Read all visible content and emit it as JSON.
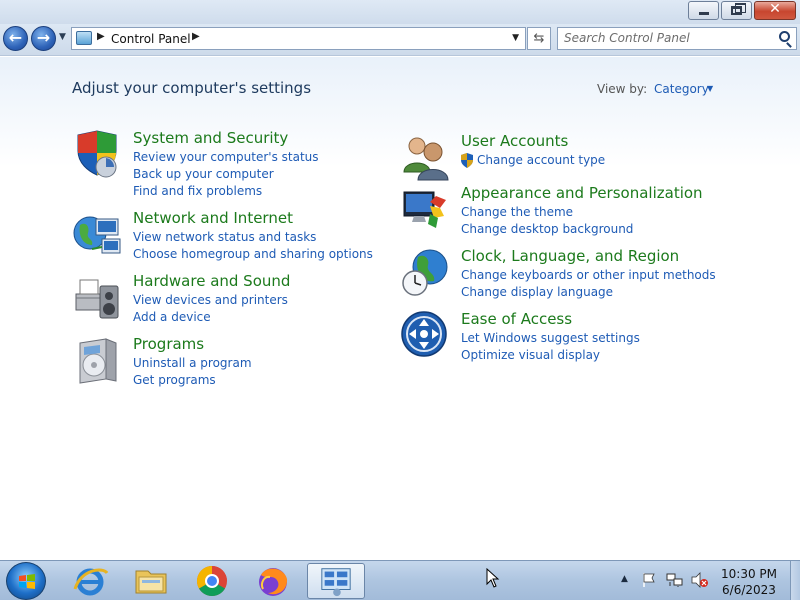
{
  "window": {
    "minimize": "minimize",
    "maximize": "restore",
    "close": "✕"
  },
  "navigation": {
    "back": "back",
    "forward": "forward",
    "breadcrumb": [
      "Control Panel"
    ],
    "search_placeholder": "Search Control Panel"
  },
  "header": {
    "title": "Adjust your computer's settings",
    "view_by_label": "View by:",
    "view_by_value": "Category"
  },
  "categories_left": [
    {
      "title": "System and Security",
      "icon": "shield-icon",
      "links": [
        "Review your computer's status",
        "Back up your computer",
        "Find and fix problems"
      ]
    },
    {
      "title": "Network and Internet",
      "icon": "network-globe-icon",
      "links": [
        "View network status and tasks",
        "Choose homegroup and sharing options"
      ]
    },
    {
      "title": "Hardware and Sound",
      "icon": "printer-speaker-icon",
      "links": [
        "View devices and printers",
        "Add a device"
      ]
    },
    {
      "title": "Programs",
      "icon": "programs-box-icon",
      "links": [
        "Uninstall a program",
        "Get programs"
      ]
    }
  ],
  "categories_right": [
    {
      "title": "User Accounts",
      "icon": "users-icon",
      "links": [
        "Change account type"
      ]
    },
    {
      "title": "Appearance and Personalization",
      "icon": "monitor-paint-icon",
      "links": [
        "Change the theme",
        "Change desktop background"
      ]
    },
    {
      "title": "Clock, Language, and Region",
      "icon": "clock-globe-icon",
      "links": [
        "Change keyboards or other input methods",
        "Change display language"
      ]
    },
    {
      "title": "Ease of Access",
      "icon": "ease-of-access-icon",
      "links": [
        "Let Windows suggest settings",
        "Optimize visual display"
      ]
    }
  ],
  "taskbar": {
    "apps": [
      "internet-explorer-icon",
      "file-explorer-icon",
      "chrome-icon",
      "firefox-icon",
      "control-panel-icon"
    ],
    "time": "10:30 PM",
    "date": "6/6/2023"
  }
}
